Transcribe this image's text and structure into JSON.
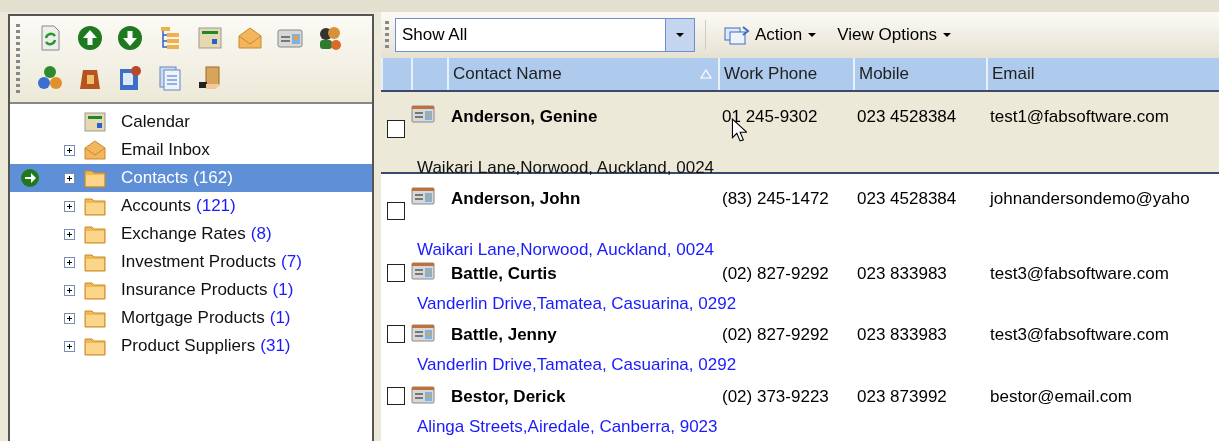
{
  "toolbar": {
    "icons": [
      {
        "kind": "refresh"
      },
      {
        "kind": "up"
      },
      {
        "kind": "down"
      },
      {
        "kind": "tree"
      },
      {
        "kind": "calendar"
      },
      {
        "kind": "envelope"
      },
      {
        "kind": "card"
      },
      {
        "kind": "people"
      },
      {
        "kind": "coins"
      },
      {
        "kind": "bag"
      },
      {
        "kind": "pinned"
      },
      {
        "kind": "documents"
      },
      {
        "kind": "boxes"
      }
    ]
  },
  "tree": {
    "items": [
      {
        "label": "Calendar",
        "kind": "calendar",
        "expandable": false,
        "selected": false
      },
      {
        "label": "Email Inbox",
        "kind": "inbox",
        "expandable": true,
        "selected": false
      },
      {
        "label": "Contacts",
        "count": "(162)",
        "kind": "folder",
        "expandable": true,
        "selected": true
      },
      {
        "label": "Accounts",
        "count": "(121)",
        "kind": "folder",
        "expandable": true,
        "selected": false
      },
      {
        "label": "Exchange Rates",
        "count": "(8)",
        "kind": "folder",
        "expandable": true,
        "selected": false
      },
      {
        "label": "Investment Products",
        "count": "(7)",
        "kind": "folder",
        "expandable": true,
        "selected": false
      },
      {
        "label": "Insurance Products",
        "count": "(1)",
        "kind": "folder",
        "expandable": true,
        "selected": false
      },
      {
        "label": "Mortgage Products",
        "count": "(1)",
        "kind": "folder",
        "expandable": true,
        "selected": false
      },
      {
        "label": "Product Suppliers",
        "count": "(31)",
        "kind": "folder",
        "expandable": true,
        "selected": false
      }
    ]
  },
  "filter": {
    "value": "Show All"
  },
  "menus": [
    {
      "label": "Action",
      "icon": true
    },
    {
      "label": "View Options",
      "icon": false
    }
  ],
  "table": {
    "columns": [
      "Contact Name",
      "Work Phone",
      "Mobile",
      "Email"
    ],
    "rows": [
      {
        "name": "Anderson, Genine",
        "work_phone": "01 245-9302",
        "mobile": "023 4528384",
        "email": "test1@fabsoftware.com",
        "address": "Waikari Lane,Norwood, Auckland, 0024",
        "checked": false,
        "selected": true
      },
      {
        "name": "Anderson, John",
        "work_phone": "(83) 245-1472",
        "mobile": "023 4528384",
        "email": "johnandersondemo@yaho",
        "address": "Waikari Lane,Norwood, Auckland, 0024",
        "checked": false,
        "selected": false
      },
      {
        "name": "Battle, Curtis",
        "work_phone": "(02) 827-9292",
        "mobile": "023 833983",
        "email": "test3@fabsoftware.com",
        "address": "Vanderlin Drive,Tamatea, Casuarina, 0292",
        "checked": false,
        "selected": false
      },
      {
        "name": "Battle, Jenny",
        "work_phone": "(02) 827-9292",
        "mobile": "023 833983",
        "email": "test3@fabsoftware.com",
        "address": "Vanderlin Drive,Tamatea, Casuarina, 0292",
        "checked": false,
        "selected": false
      },
      {
        "name": "Bestor, Derick",
        "work_phone": "(02) 373-9223",
        "mobile": "023 873992",
        "email": "bestor@email.com",
        "address": "Alinga Streets,Airedale, Canberra, 9023",
        "checked": false,
        "selected": false
      }
    ]
  }
}
